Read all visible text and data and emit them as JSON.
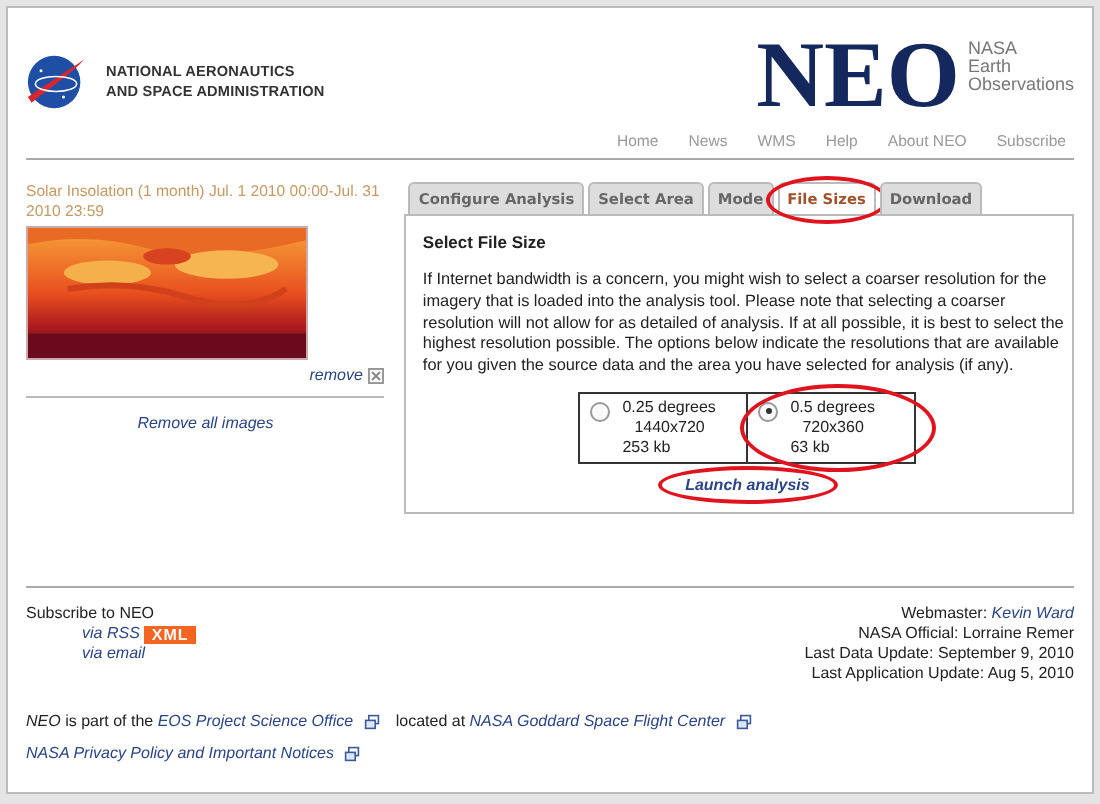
{
  "header": {
    "agency": [
      "NATIONAL AERONAUTICS",
      "AND SPACE ADMINISTRATION"
    ],
    "logo_text": "NEO",
    "logo_subtitle": [
      "NASA",
      "Earth",
      "Observations"
    ]
  },
  "nav": [
    "Home",
    "News",
    "WMS",
    "Help",
    "About NEO",
    "Subscribe"
  ],
  "sidebar": {
    "image_title": "Solar Insolation (1 month) Jul. 1 2010 00:00-Jul. 31 2010 23:59",
    "remove": "remove",
    "remove_all": "Remove all images"
  },
  "tabs": [
    {
      "label": "Configure Analysis",
      "selected": false,
      "circled": false
    },
    {
      "label": "Select Area",
      "selected": false,
      "circled": false
    },
    {
      "label": "Mode",
      "selected": false,
      "circled": false
    },
    {
      "label": "File Sizes",
      "selected": true,
      "circled": true
    },
    {
      "label": "Download",
      "selected": false,
      "circled": false
    }
  ],
  "panel": {
    "heading": "Select File Size",
    "text": "If Internet bandwidth is a concern, you might wish to select a coarser resolution for the imagery that is loaded into the analysis tool. Please note that selecting a coarser resolution will not allow for as detailed of analysis. If at all possible, it is best to select the highest resolution possible. The options below indicate the resolutions that are available for you given the source data and the area you have selected for analysis (if any).",
    "options": [
      {
        "degrees": "0.25 degrees",
        "size": "1440x720",
        "kb": "253 kb",
        "selected": false,
        "circled": false
      },
      {
        "degrees": "0.5 degrees",
        "size": "720x360",
        "kb": "63 kb",
        "selected": true,
        "circled": true
      }
    ],
    "launch": {
      "label": "Launch analysis",
      "circled": true
    }
  },
  "footer": {
    "subscribe": "Subscribe to NEO",
    "rss": "via RSS",
    "xml": "XML",
    "email": "via email",
    "right": [
      {
        "label": "Webmaster: ",
        "link": "Kevin Ward"
      },
      {
        "label": "NASA Official: Lorraine Remer"
      },
      {
        "label": "Last Data Update: September 9, 2010"
      },
      {
        "label": "Last Application Update: Aug 5, 2010"
      }
    ],
    "part_of": [
      "NEO",
      " is part of the ",
      "EOS Project Science Office",
      " located at ",
      "NASA Goddard Space Flight Center"
    ],
    "privacy": "NASA Privacy Policy and Important Notices"
  }
}
